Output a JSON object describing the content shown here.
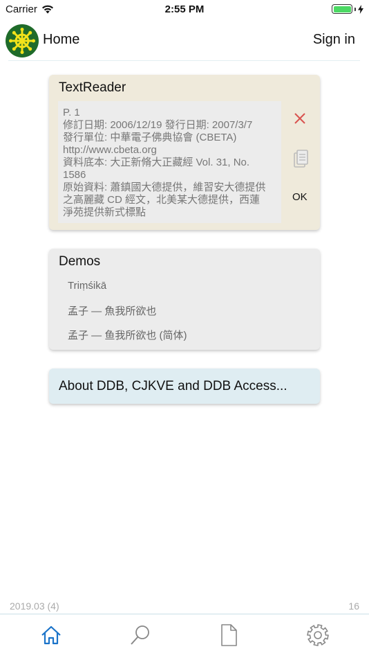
{
  "status_bar": {
    "carrier": "Carrier",
    "time": "2:55 PM",
    "battery_level": 1.0,
    "battery_color": "#4cd964"
  },
  "header": {
    "logo_icon": "dharma-wheel-icon",
    "logo_color": "#1f6b2a",
    "title": "Home",
    "sign_in": "Sign in"
  },
  "textreader": {
    "title": "TextReader",
    "lines": [
      "P. 1",
      "修訂日期: 2006/12/19   發行日期: 2007/3/7",
      "發行單位: 中華電子佛典協會 (CBETA)",
      "http://www.cbeta.org",
      "資料底本: 大正新脩大正藏經 Vol. 31, No.",
      "1586",
      "原始資料: 蕭鎮國大德提供，維習安大德提供",
      "之高麗藏 CD 經文，北美某大德提供，西蓮",
      "淨苑提供新式標點"
    ],
    "ok_label": "OK",
    "close_color": "#d9534f"
  },
  "demos": {
    "title": "Demos",
    "items": [
      "Triṃśikā",
      "孟子 — 魚我所欲也",
      "孟子 — 鱼我所欲也 (简体)"
    ]
  },
  "about": {
    "title": "About DDB, CJKVE and DDB Access..."
  },
  "footer": {
    "version": "2019.03 (4)",
    "count": "16"
  },
  "tabs": [
    {
      "icon": "home-icon",
      "active": true
    },
    {
      "icon": "search-icon",
      "active": false
    },
    {
      "icon": "document-icon",
      "active": false
    },
    {
      "icon": "gear-icon",
      "active": false
    }
  ],
  "colors": {
    "accent": "#1a73c9",
    "inactive_icon": "#888888"
  }
}
